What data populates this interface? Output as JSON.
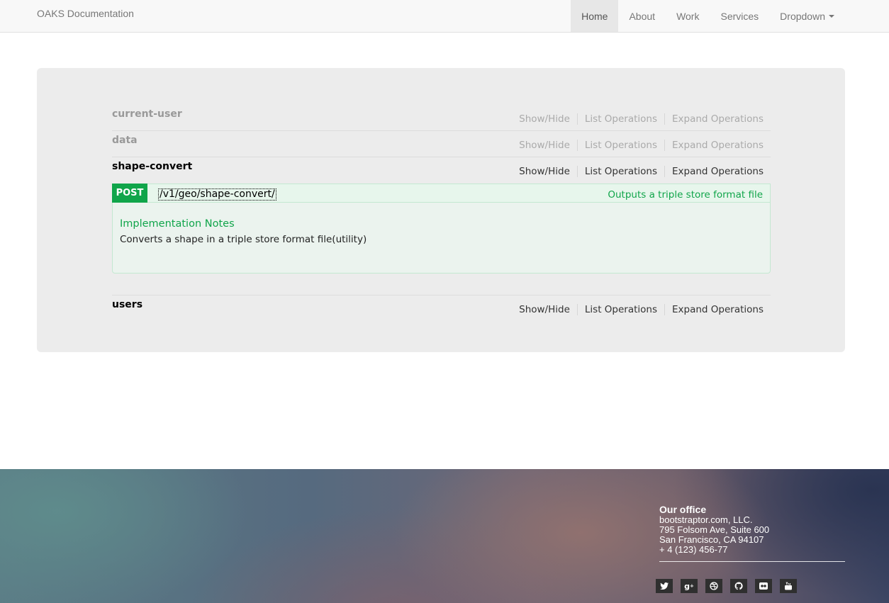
{
  "navbar": {
    "brand": "OAKS Documentation",
    "items": [
      {
        "label": "Home",
        "active": true
      },
      {
        "label": "About"
      },
      {
        "label": "Work"
      },
      {
        "label": "Services"
      },
      {
        "label": "Dropdown",
        "dropdown": true
      }
    ]
  },
  "resources": [
    {
      "name": "current-user",
      "ops": [
        "Show/Hide",
        "List Operations",
        "Expand Operations"
      ]
    },
    {
      "name": "data",
      "ops": [
        "Show/Hide",
        "List Operations",
        "Expand Operations"
      ]
    },
    {
      "name": "shape-convert",
      "ops": [
        "Show/Hide",
        "List Operations",
        "Expand Operations"
      ],
      "endpoint": {
        "method": "POST",
        "path": "/v1/geo/shape-convert/",
        "summary": "Outputs a triple store format file",
        "notes_title": "Implementation Notes",
        "notes_text": "Converts a shape in a triple store format file(utility)"
      }
    },
    {
      "name": "users",
      "ops": [
        "Show/Hide",
        "List Operations",
        "Expand Operations"
      ]
    }
  ],
  "footer": {
    "office_title": "Our office",
    "lines": [
      "bootstraptor.com, LLC.",
      "795 Folsom Ave, Suite 600",
      "San Francisco, CA 94107",
      "+ 4 (123) 456-77"
    ],
    "socials": [
      "twitter-icon",
      "google-plus-icon",
      "dribbble-icon",
      "github-icon",
      "flickr-icon",
      "youtube-icon"
    ]
  },
  "colors": {
    "post_green": "#10a54a",
    "panel_bg": "#ececec",
    "navbar_bg": "#f8f8f8"
  }
}
